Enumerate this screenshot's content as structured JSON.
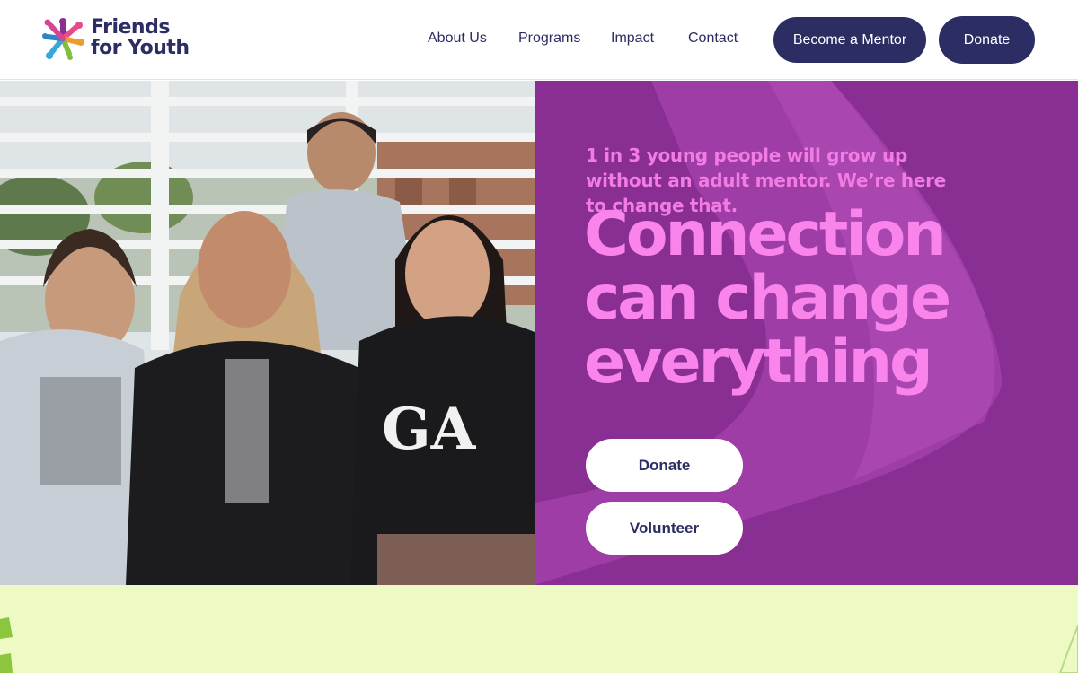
{
  "brand": {
    "name_line1": "Friends",
    "name_line2": "for Youth",
    "logo_colors": [
      "#8b2f94",
      "#e64c8c",
      "#f29a2e",
      "#3aa7d9",
      "#7fbf3a",
      "#2b2d63"
    ]
  },
  "nav": {
    "items": [
      {
        "label": "About Us"
      },
      {
        "label": "Programs"
      },
      {
        "label": "Impact"
      },
      {
        "label": "Contact"
      }
    ],
    "mentor_button": "Become a Mentor",
    "donate_button": "Donate"
  },
  "hero": {
    "kicker": "1 in 3 young people will grow up without an adult mentor. We’re here to change that.",
    "title_lines": [
      "Connection",
      "can change",
      "everything"
    ],
    "donate_button": "Donate",
    "volunteer_button": "Volunteer",
    "photo_icon": "group-photo"
  },
  "colors": {
    "navy": "#2b2d63",
    "purple_panel": "#892e93",
    "pink_text": "#f985ec",
    "lime_band": "#edfac3",
    "green_accent": "#8cc63f"
  }
}
